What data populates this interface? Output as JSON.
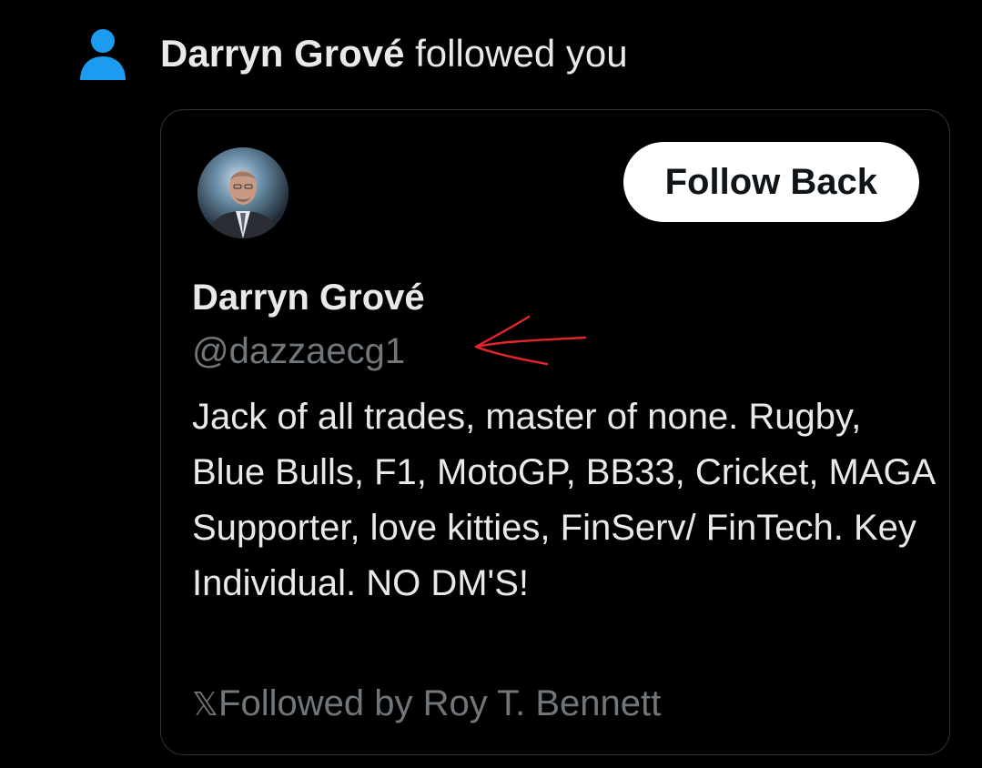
{
  "notification": {
    "actor": "Darryn Grové",
    "action": " followed you",
    "icon": "person-icon",
    "icon_color": "#1d9bf0"
  },
  "card": {
    "avatar_alt": "profile-photo",
    "follow_back_label": "Follow Back",
    "display_name": "Darryn Grové",
    "handle": "@dazzaecg1",
    "bio": "Jack of all trades, master of none. Rugby, Blue Bulls, F1, MotoGP, BB33, Cricket, MAGA Supporter, love kitties, FinServ/ FinTech. Key Individual. NO DM'S!",
    "followed_by_glyph": "𝕏",
    "followed_by": "Followed by Roy T. Bennett"
  },
  "colors": {
    "background": "#000000",
    "text_primary": "#e7e9ea",
    "text_secondary": "#71767b",
    "accent": "#1d9bf0",
    "border": "#2f3336",
    "annotation_arrow": "#e0262b"
  }
}
